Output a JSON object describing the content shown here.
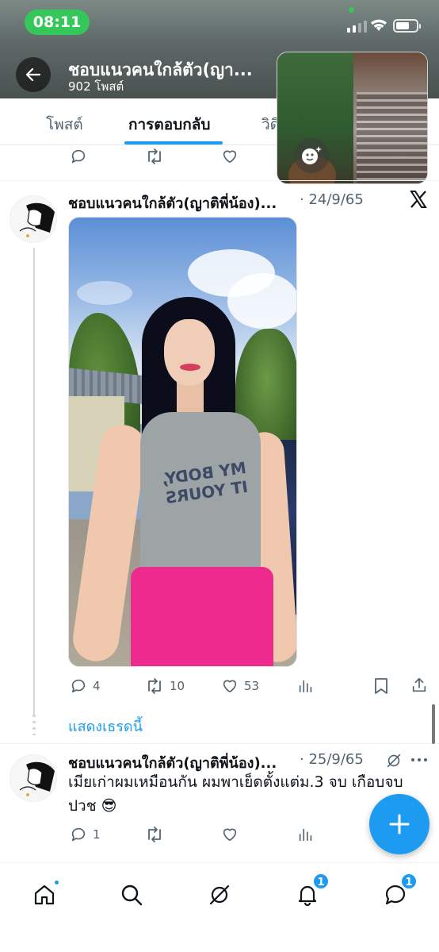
{
  "status_bar": {
    "time": "08:11"
  },
  "header": {
    "title": "ชอบแนวคนใกล้ตัว(ญา...",
    "post_count": "902 โพสต์"
  },
  "tabs": [
    {
      "label": "โพสต์",
      "active": false
    },
    {
      "label": "การตอบกลับ",
      "active": true
    },
    {
      "label": "วิดี",
      "active": false
    }
  ],
  "tweet_1": {
    "author": "ชอบแนวคนใกล้ตัว(ญาติพี่น้อง)...",
    "date": "· 24/9/65",
    "photo_shirt_text": "MY BODY, IT YOURS",
    "replies": "4",
    "reposts": "10",
    "likes": "53"
  },
  "show_thread": "แสดงเธรดนี้",
  "tweet_2": {
    "author": "ชอบแนวคนใกล้ตัว(ญาติพี่น้อง)...",
    "date": "· 25/9/65",
    "text": "เมียเก่าผมเหมือนกัน ผมพาเย็ดตั้งแต่ม.3 จบ เกือบจบ ปวช 😎",
    "replies": "1"
  },
  "bottom_nav": {
    "notifications_badge": "1",
    "messages_badge": "1"
  },
  "colors": {
    "accent": "#1d9bf0",
    "secondary_text": "#536471"
  },
  "icons": [
    "back-arrow-icon",
    "face-effect-icon",
    "x-logo-icon",
    "reply-icon",
    "repost-icon",
    "like-icon",
    "views-icon",
    "bookmark-icon",
    "share-icon",
    "grok-icon",
    "more-icon",
    "compose-icon",
    "home-icon",
    "search-icon",
    "notifications-icon",
    "messages-icon"
  ]
}
